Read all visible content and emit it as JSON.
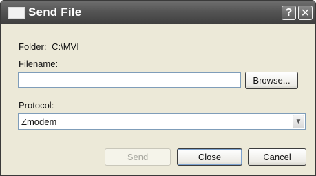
{
  "window": {
    "title": "Send File",
    "help_glyph": "?",
    "close_glyph": "✕"
  },
  "folder": {
    "label": "Folder:",
    "value": "C:\\MVI"
  },
  "filename": {
    "label": "Filename:",
    "value": "",
    "browse_label": "Browse..."
  },
  "protocol": {
    "label": "Protocol:",
    "selected": "Zmodem",
    "arrow_glyph": "▼"
  },
  "buttons": {
    "send_label": "Send",
    "close_label": "Close",
    "cancel_label": "Cancel"
  }
}
